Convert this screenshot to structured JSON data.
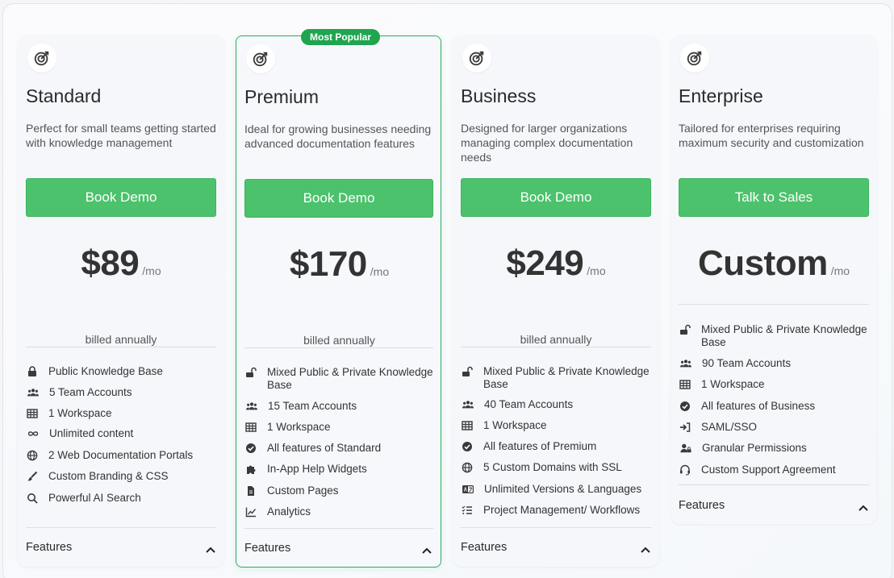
{
  "popular_badge": "Most Popular",
  "billed_text": "billed annually",
  "features_footer": "Features",
  "accent_color": "#4bc26b",
  "plans": [
    {
      "name": "Standard",
      "description": "Perfect for small teams getting started with knowledge management",
      "cta": "Book Demo",
      "price": "$89",
      "period": "/mo",
      "features": [
        {
          "icon": "lock-icon",
          "text": "Public Knowledge Base"
        },
        {
          "icon": "users-icon",
          "text": "5 Team Accounts"
        },
        {
          "icon": "table-icon",
          "text": "1 Workspace"
        },
        {
          "icon": "infinity-icon",
          "text": "Unlimited content"
        },
        {
          "icon": "globe-icon",
          "text": "2 Web Documentation Portals"
        },
        {
          "icon": "brush-icon",
          "text": "Custom Branding & CSS"
        },
        {
          "icon": "search-icon",
          "text": "Powerful AI Search"
        }
      ]
    },
    {
      "name": "Premium",
      "description": "Ideal for growing businesses needing advanced documentation features",
      "cta": "Book Demo",
      "price": "$170",
      "period": "/mo",
      "features": [
        {
          "icon": "unlock-icon",
          "text": "Mixed Public & Private Knowledge Base"
        },
        {
          "icon": "users-icon",
          "text": "15 Team Accounts"
        },
        {
          "icon": "table-icon",
          "text": "1 Workspace"
        },
        {
          "icon": "check-circle-icon",
          "text": "All features of Standard"
        },
        {
          "icon": "puzzle-icon",
          "text": "In-App Help Widgets"
        },
        {
          "icon": "file-icon",
          "text": "Custom Pages"
        },
        {
          "icon": "chart-line-icon",
          "text": "Analytics"
        }
      ]
    },
    {
      "name": "Business",
      "description": "Designed for larger organizations managing complex documentation needs",
      "cta": "Book Demo",
      "price": "$249",
      "period": "/mo",
      "features": [
        {
          "icon": "unlock-icon",
          "text": "Mixed Public & Private Knowledge Base"
        },
        {
          "icon": "users-icon",
          "text": "40 Team Accounts"
        },
        {
          "icon": "table-icon",
          "text": "1 Workspace"
        },
        {
          "icon": "check-circle-icon",
          "text": "All features of Premium"
        },
        {
          "icon": "globe-icon",
          "text": "5 Custom Domains with SSL"
        },
        {
          "icon": "language-icon",
          "text": "Unlimited Versions & Languages"
        },
        {
          "icon": "list-check-icon",
          "text": "Project Management/ Workflows"
        }
      ]
    },
    {
      "name": "Enterprise",
      "description": "Tailored for enterprises requiring maximum security and customization",
      "cta": "Talk to Sales",
      "price": "Custom",
      "period": "/mo",
      "features": [
        {
          "icon": "unlock-icon",
          "text": "Mixed Public & Private Knowledge Base"
        },
        {
          "icon": "users-icon",
          "text": "90 Team Accounts"
        },
        {
          "icon": "table-icon",
          "text": "1 Workspace"
        },
        {
          "icon": "check-circle-icon",
          "text": "All features of Business"
        },
        {
          "icon": "sign-in-icon",
          "text": "SAML/SSO"
        },
        {
          "icon": "user-lock-icon",
          "text": "Granular Permissions"
        },
        {
          "icon": "headset-icon",
          "text": "Custom Support Agreement"
        }
      ]
    }
  ]
}
